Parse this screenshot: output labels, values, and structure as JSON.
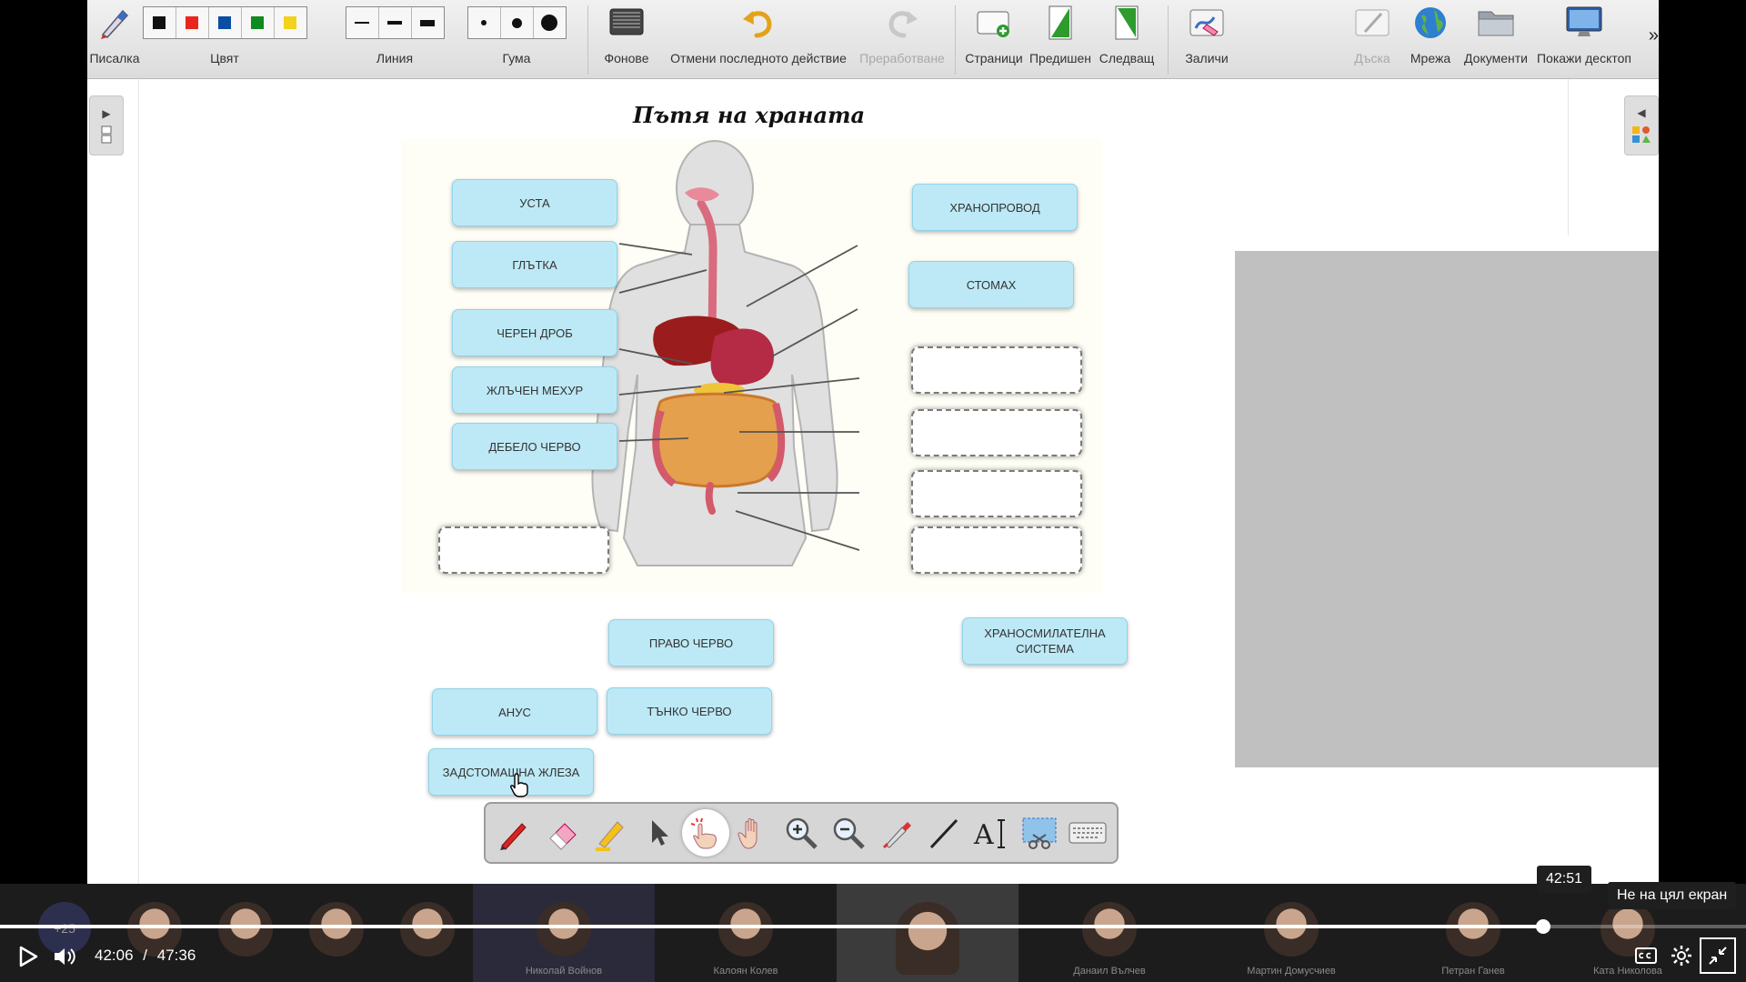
{
  "toolbar": {
    "pen": "Писалка",
    "color": "Цвят",
    "line": "Линия",
    "eraser": "Гума",
    "backgrounds": "Фонове",
    "undo": "Отмени последното действие",
    "redo": "Преработване",
    "pages": "Страници",
    "previous": "Предишен",
    "next": "Следващ",
    "clear": "Заличи",
    "board": "Дъска",
    "network": "Мрежа",
    "documents": "Документи",
    "show_desktop": "Покажи десктоп",
    "more": "»",
    "colors": [
      "#111111",
      "#e8261c",
      "#0a4ea3",
      "#0f8a1e",
      "#f2d21b"
    ]
  },
  "page": {
    "title": "Пътя на храната"
  },
  "labels": {
    "mouth": "УСТА",
    "pharynx": "ГЛЪТКА",
    "liver": "ЧЕРЕН ДРОБ",
    "gallbladder": "ЖЛЪЧЕН МЕХУР",
    "large_intestine": "ДЕБЕЛО ЧЕРВО",
    "esophagus": "ХРАНОПРОВОД",
    "stomach": "СТОМАХ",
    "rectum": "ПРАВО ЧЕРВО",
    "digestive_system": "ХРАНОСМИЛАТЕЛНА СИСТЕМА",
    "anus": "АНУС",
    "small_intestine": "ТЪНКО ЧЕРВО",
    "pancreas": "ЗАДСТОМАШНА ЖЛЕЗА"
  },
  "video": {
    "current_time": "42:06",
    "separator": "/",
    "duration": "47:36",
    "progress": 0.884,
    "hover_time": "42:51",
    "exit_fullscreen_tip": "Не на цял екран",
    "extra_participants": "+25",
    "participants": [
      "Николай Войнов",
      "Калоян Колев",
      "Данаил Вълчев",
      "Мартин Домусчиев",
      "Петран Ганев",
      "Ката Николова"
    ]
  }
}
